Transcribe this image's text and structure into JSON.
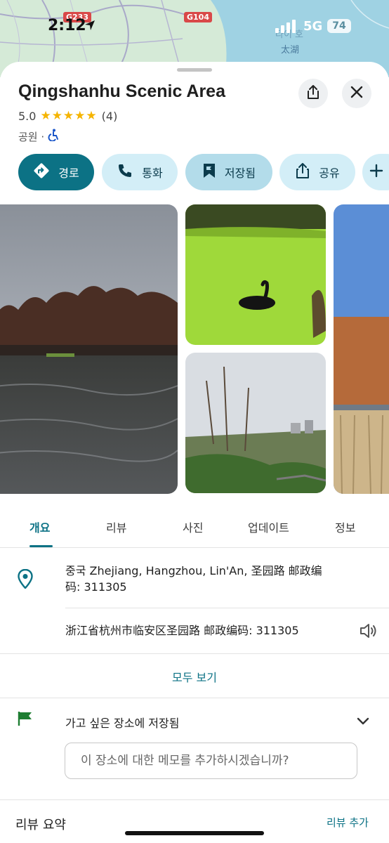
{
  "status_bar": {
    "time": "2:12",
    "network": "5G",
    "battery": "74"
  },
  "map": {
    "road_badges": [
      "G233",
      "G104"
    ],
    "labels": [
      "太湖",
      "타이 호"
    ]
  },
  "place": {
    "title": "Qingshanhu Scenic Area",
    "rating": "5.0",
    "stars": "★★★★★",
    "review_count": "(4)",
    "category": "공원 ·"
  },
  "actions": {
    "directions": "경로",
    "call": "통화",
    "saved": "저장됨",
    "share": "공유"
  },
  "tabs": [
    "개요",
    "리뷰",
    "사진",
    "업데이트",
    "정보"
  ],
  "address": {
    "line1": "중국 Zhejiang, Hangzhou, Lin'An, 圣园路 邮政编",
    "line2": "码: 311305",
    "local": "浙江省杭州市临安区圣园路 邮政编码: 311305",
    "see_all": "모두 보기"
  },
  "saved_list": {
    "label": "가고 싶은 장소에 저장됨",
    "memo_placeholder": "이 장소에 대한 메모를 추가하시겠습니까?"
  },
  "reviews": {
    "title": "리뷰 요약",
    "add": "리뷰 추가"
  },
  "colors": {
    "accent": "#0c7285",
    "chip": "#d3eef7",
    "star": "#f5b400",
    "flag": "#1e7d32"
  },
  "icons": [
    "location-arrow-icon",
    "signal-icon",
    "share-icon",
    "close-icon",
    "star-icon",
    "wheelchair-icon",
    "directions-icon",
    "phone-icon",
    "bookmark-flag-icon",
    "plus-icon",
    "map-pin-icon",
    "speaker-icon",
    "flag-icon",
    "chevron-down-icon"
  ]
}
